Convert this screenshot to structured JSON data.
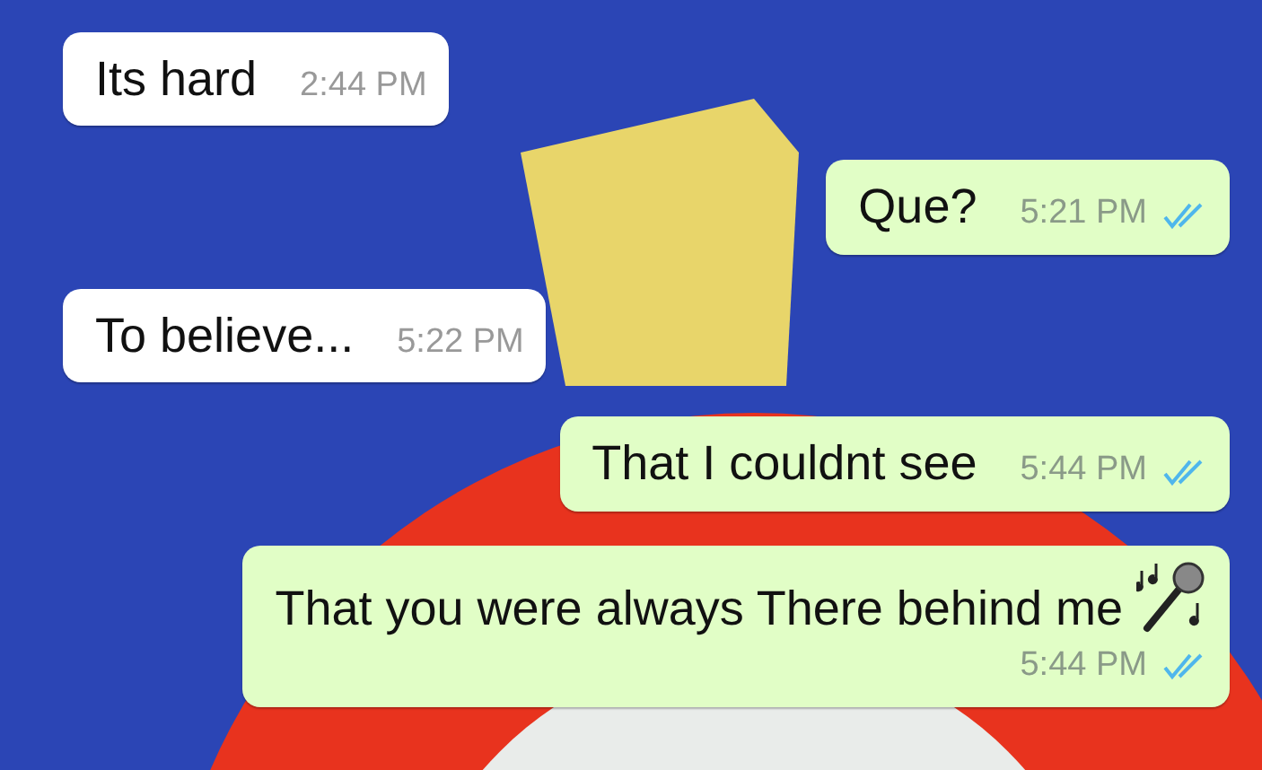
{
  "messages": [
    {
      "kind": "incoming",
      "text": "Its hard",
      "time": "2:44 PM"
    },
    {
      "kind": "outgoing",
      "text": "Que?",
      "time": "5:21 PM",
      "read": true
    },
    {
      "kind": "incoming",
      "text": "To believe...",
      "time": "5:22 PM"
    },
    {
      "kind": "outgoing",
      "text": "That I couldnt see",
      "time": "5:44 PM",
      "read": true
    },
    {
      "kind": "outgoing",
      "text": "That you were always There behind me",
      "time": "5:44 PM",
      "read": true,
      "has_icon": true
    }
  ]
}
